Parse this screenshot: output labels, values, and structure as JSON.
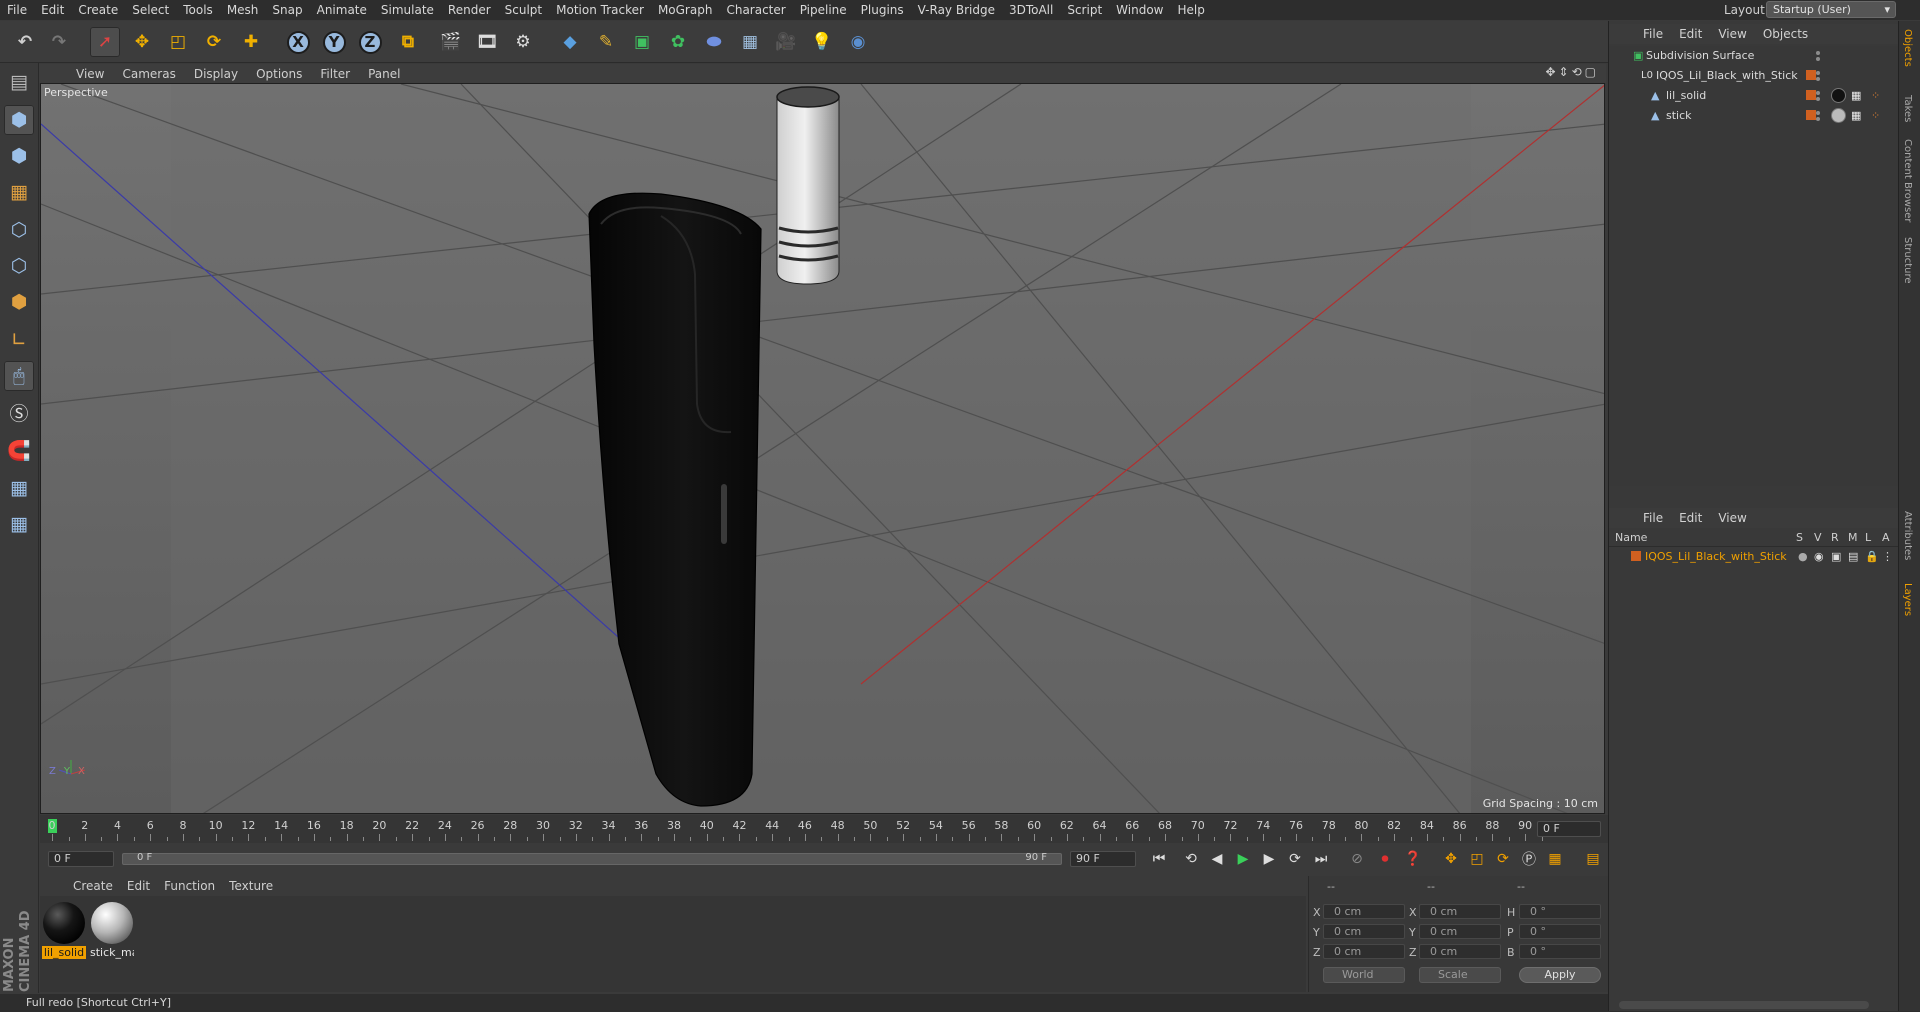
{
  "menubar": {
    "items": [
      "File",
      "Edit",
      "Create",
      "Select",
      "Tools",
      "Mesh",
      "Snap",
      "Animate",
      "Simulate",
      "Render",
      "Sculpt",
      "Motion Tracker",
      "MoGraph",
      "Character",
      "Pipeline",
      "Plugins",
      "V-Ray Bridge",
      "3DToAll",
      "Script",
      "Window",
      "Help"
    ],
    "layout_label": "Layout:",
    "layout_value": "Startup (User)"
  },
  "toolbar": {
    "axes": [
      "X",
      "Y",
      "Z"
    ]
  },
  "viewport": {
    "menu": [
      "View",
      "Cameras",
      "Display",
      "Options",
      "Filter",
      "Panel"
    ],
    "camera_label": "Perspective",
    "grid_spacing": "Grid Spacing : 10 cm",
    "axis_labels": [
      "Z",
      "Y",
      "X"
    ],
    "background": "#666666"
  },
  "timeline": {
    "ticks": [
      "0",
      "2",
      "4",
      "6",
      "8",
      "10",
      "12",
      "14",
      "16",
      "18",
      "20",
      "22",
      "24",
      "26",
      "28",
      "30",
      "32",
      "34",
      "36",
      "38",
      "40",
      "42",
      "44",
      "46",
      "48",
      "50",
      "52",
      "54",
      "56",
      "58",
      "60",
      "62",
      "64",
      "66",
      "68",
      "70",
      "72",
      "74",
      "76",
      "78",
      "80",
      "82",
      "84",
      "86",
      "88",
      "90"
    ],
    "current_frame": "0 F",
    "start_field": "0 F",
    "range_start": "0 F",
    "range_end": "90 F",
    "end_field": "90 F"
  },
  "material_menu": [
    "Create",
    "Edit",
    "Function",
    "Texture"
  ],
  "materials": [
    {
      "name": "lil_solid",
      "selected": true,
      "color": "#151515"
    },
    {
      "name": "stick_ma",
      "selected": false,
      "color": "#b5b5b5"
    }
  ],
  "coordinates": {
    "headers": [
      "--",
      "--",
      "--"
    ],
    "rows": [
      {
        "a": "X",
        "a_val": "0 cm",
        "b": "X",
        "b_val": "0 cm",
        "c": "H",
        "c_val": "0 °"
      },
      {
        "a": "Y",
        "a_val": "0 cm",
        "b": "Y",
        "b_val": "0 cm",
        "c": "P",
        "c_val": "0 °"
      },
      {
        "a": "Z",
        "a_val": "0 cm",
        "b": "Z",
        "b_val": "0 cm",
        "c": "B",
        "c_val": "0 °"
      }
    ],
    "world": "World",
    "scale": "Scale",
    "apply": "Apply"
  },
  "objects_panel": {
    "menu": [
      "File",
      "Edit",
      "View",
      "Objects"
    ],
    "items": [
      {
        "name": "Subdivision Surface",
        "indent": 0,
        "icon": "subdivision-icon"
      },
      {
        "name": "IQOS_Lil_Black_with_Stick",
        "indent": 1,
        "icon": "null-object-icon"
      },
      {
        "name": "lil_solid",
        "indent": 2,
        "icon": "polygon-object-icon"
      },
      {
        "name": "stick",
        "indent": 2,
        "icon": "polygon-object-icon"
      }
    ]
  },
  "layers_panel": {
    "menu": [
      "File",
      "Edit",
      "View"
    ],
    "columns": [
      "Name",
      "S",
      "V",
      "R",
      "M",
      "L",
      "A"
    ],
    "rows": [
      {
        "name": "IQOS_Lil_Black_with_Stick",
        "color": "#d06020"
      }
    ]
  },
  "side_tabs": [
    "Objects",
    "Takes",
    "Content Browser",
    "Structure",
    "Attributes",
    "Layers"
  ],
  "status": "Full redo [Shortcut Ctrl+Y]",
  "brand": "MAXON CINEMA 4D",
  "colors": {
    "accent": "#f0a000",
    "orange": "#d06020",
    "blue_icon": "#98b9dd"
  }
}
